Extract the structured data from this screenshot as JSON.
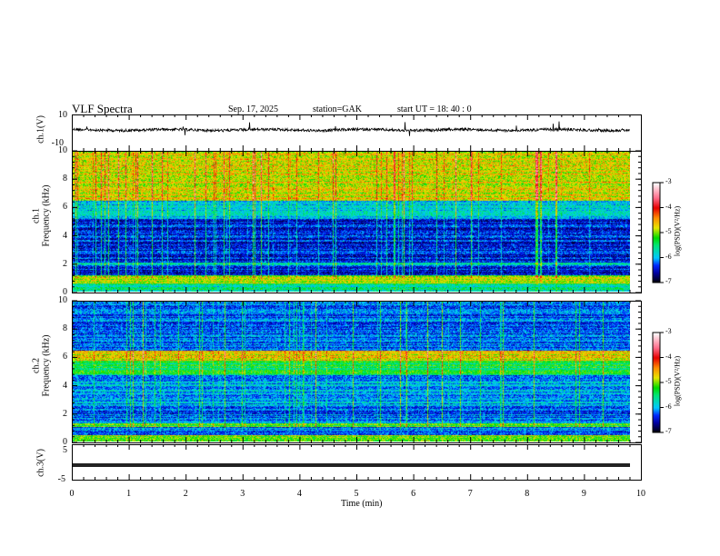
{
  "header": {
    "title": "VLF  Spectra",
    "date": "Sep. 17, 2025",
    "station": "station=GAK",
    "start": "start  UT  =    18: 40 : 0"
  },
  "chart_data": [
    {
      "type": "line",
      "name": "ch1-waveform",
      "ylabel": "ch.1(V)",
      "ylim": [
        -10,
        10
      ],
      "yticks": [
        "10",
        "-10"
      ],
      "description_level": 0
    },
    {
      "type": "heatmap",
      "name": "ch1-spectrogram",
      "ylabel": "ch.1\nFrequency  (kHz)",
      "ylabel_top": "ch.1",
      "ylabel_bottom": "Frequency  (kHz)",
      "ylim": [
        0,
        10
      ],
      "yticks": [
        "0",
        "2",
        "4",
        "6",
        "8",
        "10"
      ],
      "colorbar": {
        "label": "log(PSD)(V²/Hz)",
        "range": [
          -7,
          -3
        ],
        "ticks": [
          "-3",
          "-4",
          "-5",
          "-6",
          "-7"
        ]
      }
    },
    {
      "type": "heatmap",
      "name": "ch2-spectrogram",
      "ylabel_top": "ch.2",
      "ylabel_bottom": "Frequency  (kHz)",
      "ylim": [
        0,
        10
      ],
      "yticks": [
        "0",
        "2",
        "4",
        "6",
        "8",
        "10"
      ],
      "colorbar": {
        "label": "log(PSD)(V²/Hz)",
        "range": [
          -7,
          -3
        ],
        "ticks": [
          "-3",
          "-4",
          "-5",
          "-6",
          "-7"
        ]
      }
    },
    {
      "type": "line",
      "name": "ch3-waveform",
      "ylabel": "ch.3(V)",
      "ylim": [
        -5,
        5
      ],
      "yticks": [
        "5",
        "-5"
      ],
      "level": 0
    }
  ],
  "xaxis": {
    "label": "Time  (min)",
    "xlim": [
      0,
      10
    ],
    "ticks": [
      "0",
      "1",
      "2",
      "3",
      "4",
      "5",
      "6",
      "7",
      "8",
      "9",
      "10"
    ]
  },
  "colors": {
    "axis": "#000000"
  }
}
